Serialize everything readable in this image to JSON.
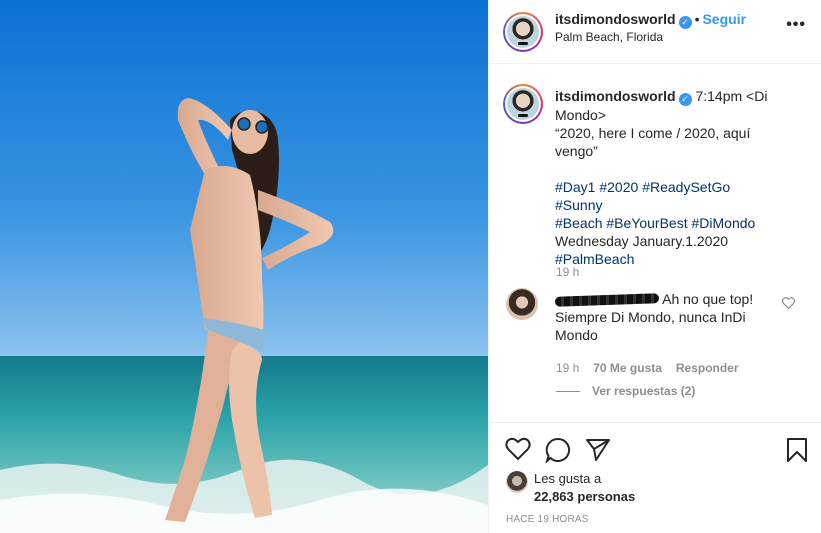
{
  "post": {
    "username": "itsdimondosworld",
    "follow_label": "Seguir",
    "location": "Palm Beach, Florida",
    "more_label": "•••"
  },
  "caption": {
    "username": "itsdimondosworld",
    "time": "7:14pm",
    "line1": "<Di Mondo>",
    "line2": "“2020, here I come / 2020, aquí vengo”",
    "tags_line1": [
      "#Day1",
      "#2020",
      "#ReadySetGo",
      "#Sunny"
    ],
    "tags_line2": [
      "#Beach",
      "#BeYourBest",
      "#DiMondo"
    ],
    "date_line": "Wednesday January.1.2020",
    "tag_last": "#PalmBeach",
    "age": "19 h"
  },
  "comment": {
    "text": "Ah no que top! Siempre Di Mondo, nunca InDi Mondo",
    "age": "19 h",
    "likes": "70 Me gusta",
    "reply_label": "Responder",
    "view_replies": "Ver respuestas (2)"
  },
  "footer": {
    "likes_prefix": "Les gusta a",
    "likes_count": "22,863 personas",
    "time_ago": "HACE 19 HORAS"
  },
  "icons": [
    "heart-icon",
    "comment-icon",
    "share-icon",
    "bookmark-icon",
    "verified-icon",
    "more-icon"
  ],
  "colors": {
    "accent": "#3897f0",
    "hashtag": "#003569",
    "muted": "#8e8e8e"
  }
}
